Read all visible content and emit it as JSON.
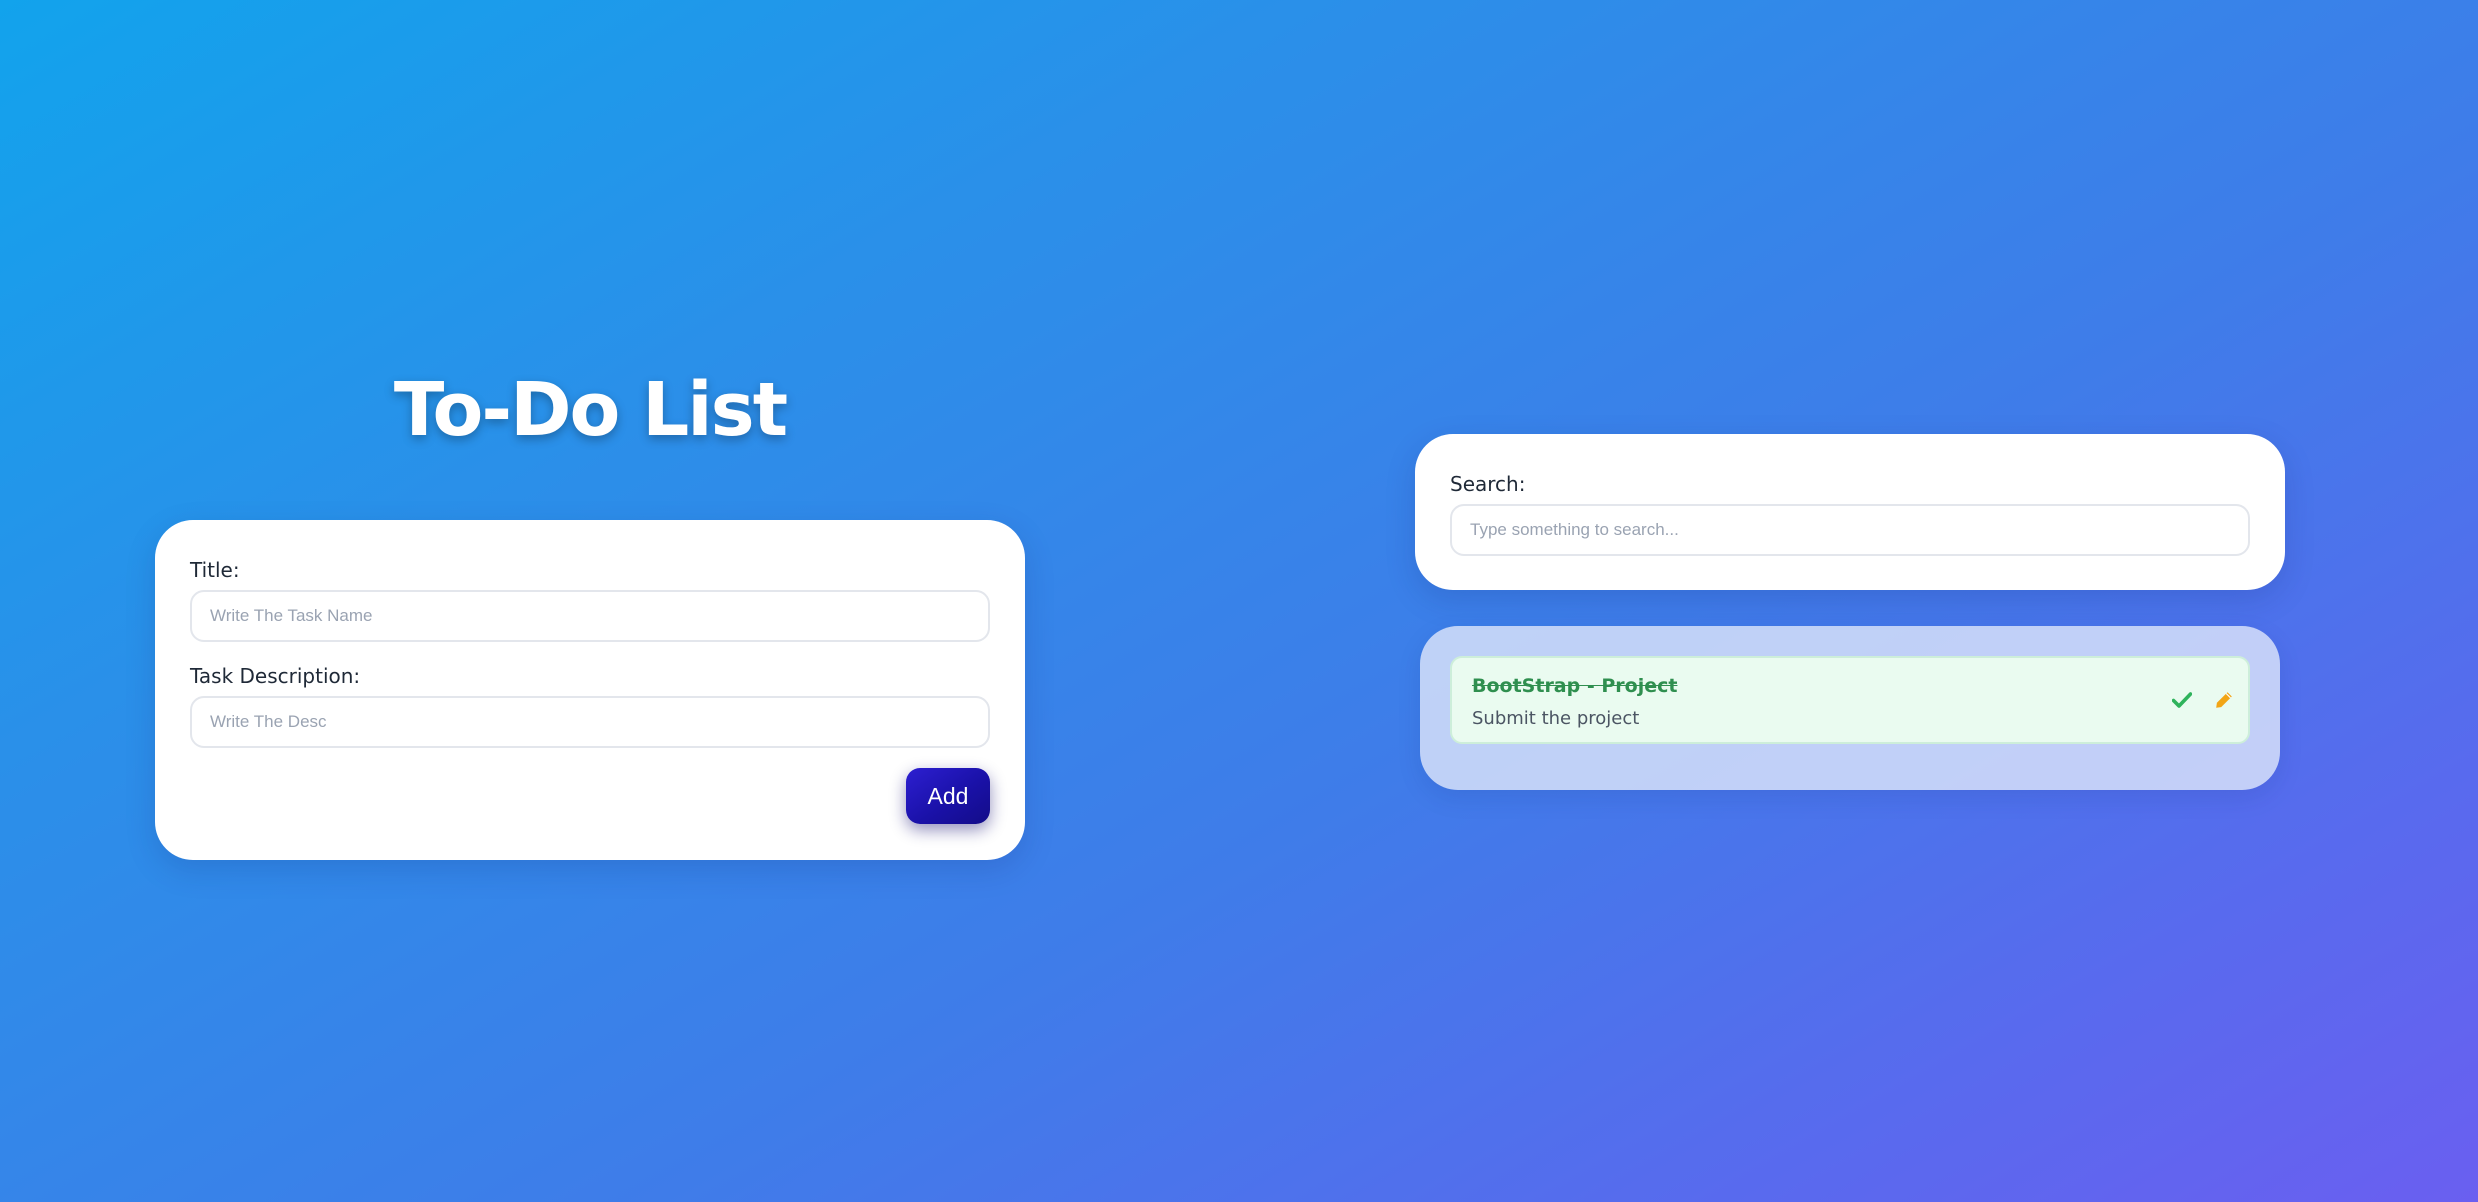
{
  "header": {
    "title": "To-Do List"
  },
  "form": {
    "title_label": "Title:",
    "title_placeholder": "Write The Task Name",
    "title_value": "",
    "desc_label": "Task Description:",
    "desc_placeholder": "Write The Desc",
    "desc_value": "",
    "add_label": "Add"
  },
  "search": {
    "label": "Search:",
    "placeholder": "Type something to search...",
    "value": ""
  },
  "tasks": [
    {
      "title": "BootStrap - Project",
      "description": "Submit the project",
      "completed": true,
      "icons": [
        "check-icon",
        "pencil-icon"
      ]
    }
  ],
  "colors": {
    "accent_button": "#1a11a8",
    "completed_text": "#2f8f4f",
    "check_icon": "#2fb35c",
    "edit_icon": "#f2a516"
  }
}
